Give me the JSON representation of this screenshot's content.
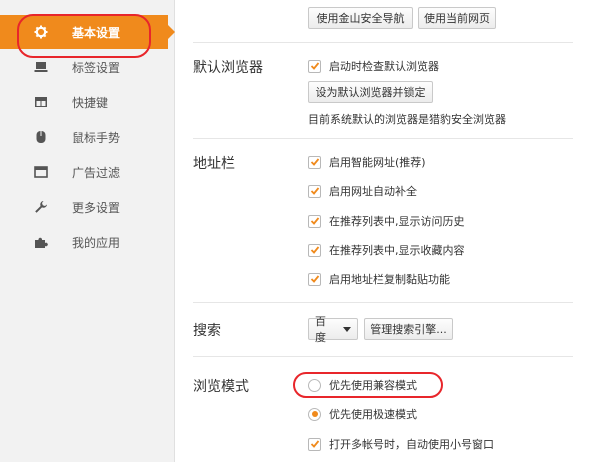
{
  "sidebar": {
    "items": [
      {
        "label": "基本设置",
        "icon": "gear-icon",
        "active": true
      },
      {
        "label": "标签设置",
        "icon": "laptop-icon"
      },
      {
        "label": "快捷键",
        "icon": "keyboard-icon"
      },
      {
        "label": "鼠标手势",
        "icon": "mouse-icon"
      },
      {
        "label": "广告过滤",
        "icon": "window-icon"
      },
      {
        "label": "更多设置",
        "icon": "wrench-icon"
      },
      {
        "label": "我的应用",
        "icon": "puzzle-icon"
      }
    ]
  },
  "main": {
    "top_buttons": {
      "use_nav": "使用金山安全导航",
      "use_current": "使用当前网页"
    },
    "default_browser": {
      "title": "默认浏览器",
      "check_on_start": "启动时检查默认浏览器",
      "set_default_button": "设为默认浏览器并锁定",
      "status": "目前系统默认的浏览器是猎豹安全浏览器"
    },
    "address_bar": {
      "title": "地址栏",
      "options": [
        "启用智能网址(推荐)",
        "启用网址自动补全",
        "在推荐列表中,显示访问历史",
        "在推荐列表中,显示收藏内容",
        "启用地址栏复制黏贴功能"
      ]
    },
    "search": {
      "title": "搜索",
      "engine": "百度",
      "manage_button": "管理搜索引擎..."
    },
    "browse_mode": {
      "title": "浏览模式",
      "option_compat": "优先使用兼容模式",
      "option_speed": "优先使用极速模式",
      "multi_account": "打开多帐号时，自动使用小号窗口"
    }
  },
  "colors": {
    "accent": "#f08a1c",
    "highlight_oval": "#e8262b",
    "sidebar_bg": "#f2f2f2"
  }
}
